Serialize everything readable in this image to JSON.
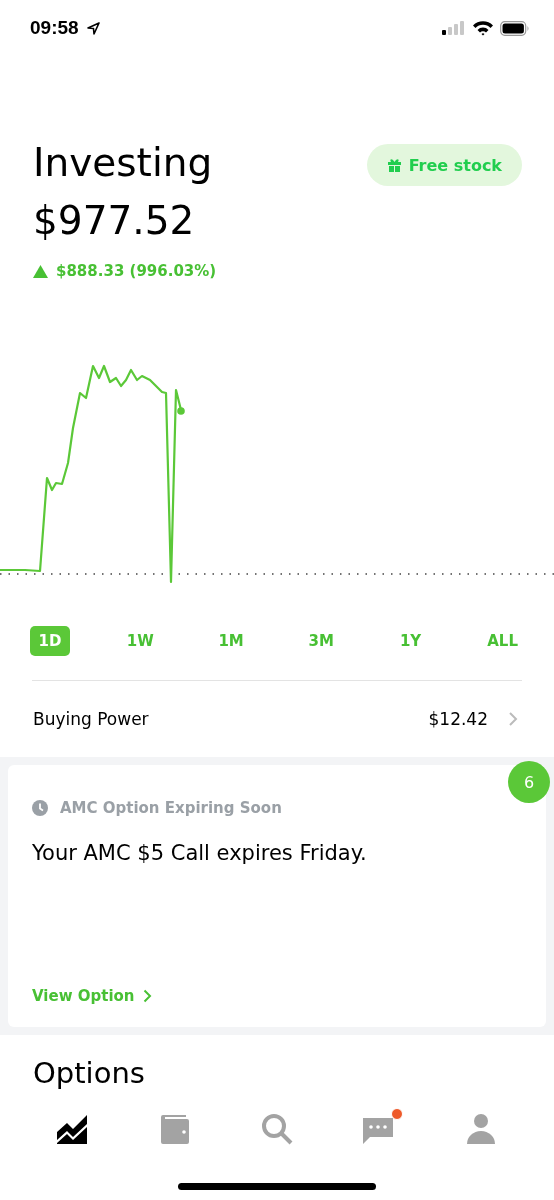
{
  "status_bar": {
    "time": "09:58"
  },
  "header": {
    "title": "Investing",
    "value": "$977.52",
    "promo_button": "Free stock",
    "change": "$888.33 (996.03%)",
    "gain": true
  },
  "ranges": [
    {
      "label": "1D",
      "selected": true
    },
    {
      "label": "1W",
      "selected": false
    },
    {
      "label": "1M",
      "selected": false
    },
    {
      "label": "3M",
      "selected": false
    },
    {
      "label": "1Y",
      "selected": false
    },
    {
      "label": "ALL",
      "selected": false
    }
  ],
  "buying_power": {
    "label": "Buying Power",
    "value": "$12.42"
  },
  "card": {
    "badge": "6",
    "title": "AMC Option Expiring Soon",
    "message": "Your AMC $5 Call expires Friday.",
    "link": "View Option"
  },
  "section_title": "Options",
  "tab_bar": [
    {
      "kind": "chart",
      "selected": true,
      "dot": false
    },
    {
      "kind": "wallet",
      "selected": false,
      "dot": false
    },
    {
      "kind": "search",
      "selected": false,
      "dot": false
    },
    {
      "kind": "messages",
      "selected": false,
      "dot": true
    },
    {
      "kind": "account",
      "selected": false,
      "dot": false
    }
  ]
}
